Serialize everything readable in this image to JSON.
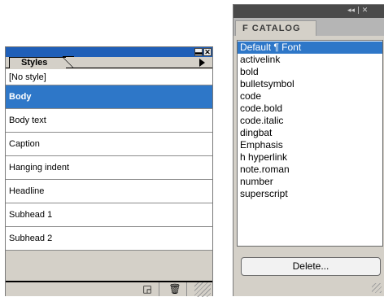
{
  "styles_palette": {
    "tab_label": "Styles",
    "titlebar": {
      "minimize": "▬",
      "close": "✕"
    },
    "items": [
      {
        "label": "[No style]",
        "selected": false
      },
      {
        "label": "Body",
        "selected": true
      },
      {
        "label": "Body text",
        "selected": false
      },
      {
        "label": "Caption",
        "selected": false
      },
      {
        "label": "Hanging indent",
        "selected": false
      },
      {
        "label": "Headline",
        "selected": false
      },
      {
        "label": "Subhead 1",
        "selected": false
      },
      {
        "label": "Subhead 2",
        "selected": false
      }
    ],
    "bottom_icons": {
      "new_style": "◲",
      "trash": "🗑"
    }
  },
  "catalog_palette": {
    "tab_label": "F CATALOG",
    "titlebar_controls": "◂◂ | ✕",
    "items": [
      {
        "label": "Default ¶ Font",
        "selected": true
      },
      {
        "label": "activelink",
        "selected": false
      },
      {
        "label": "bold",
        "selected": false
      },
      {
        "label": "bulletsymbol",
        "selected": false
      },
      {
        "label": "code",
        "selected": false
      },
      {
        "label": "code.bold",
        "selected": false
      },
      {
        "label": "code.italic",
        "selected": false
      },
      {
        "label": "dingbat",
        "selected": false
      },
      {
        "label": "Emphasis",
        "selected": false
      },
      {
        "label": "h hyperlink",
        "selected": false
      },
      {
        "label": "note.roman",
        "selected": false
      },
      {
        "label": "number",
        "selected": false
      },
      {
        "label": "superscript",
        "selected": false
      }
    ],
    "delete_label": "Delete..."
  },
  "colors": {
    "selection": "#2e77c8",
    "styles_titlebar": "#1f5fb8",
    "catalog_titlebar": "#4a4a4a",
    "panel_bg": "#d4d0c8"
  }
}
